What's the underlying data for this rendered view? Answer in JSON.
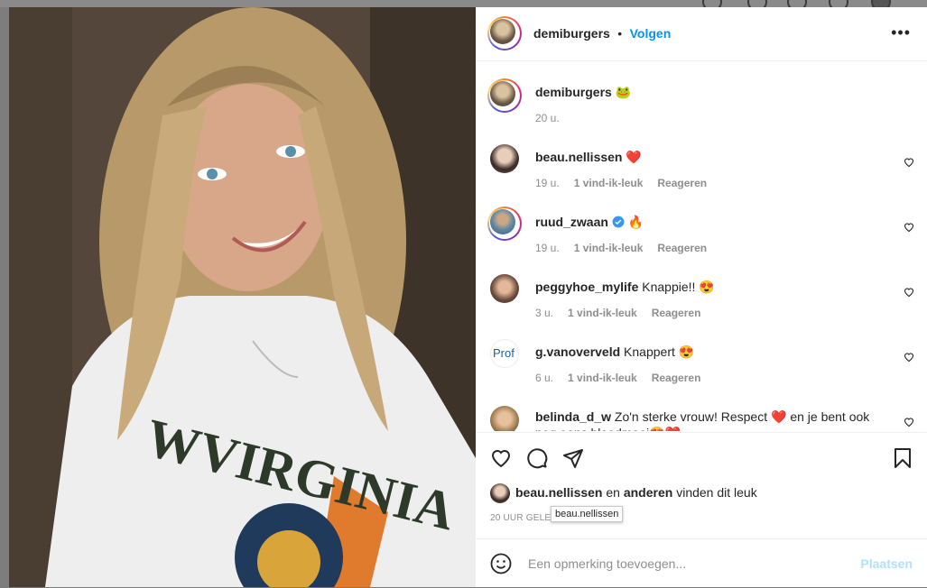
{
  "post": {
    "author": "demiburgers",
    "follow_label": "Volgen",
    "separator": "•",
    "more_label": "•••",
    "caption_emoji": "🐸",
    "caption_time": "20 u."
  },
  "comments": [
    {
      "user": "beau.nellissen",
      "text": "",
      "emoji": "❤️",
      "time": "19 u.",
      "likes": "1 vind-ik-leuk",
      "reply": "Reageren"
    },
    {
      "user": "ruud_zwaan",
      "text": "",
      "emoji": "🔥",
      "verified": true,
      "time": "19 u.",
      "likes": "1 vind-ik-leuk",
      "reply": "Reageren"
    },
    {
      "user": "peggyhoe_mylife",
      "text": "Knappie!!",
      "emoji": "😍",
      "time": "3 u.",
      "likes": "1 vind-ik-leuk",
      "reply": "Reageren"
    },
    {
      "user": "g.vanoverveld",
      "text": "Knappert",
      "emoji": "😍",
      "avatar_text": "Prof",
      "time": "6 u.",
      "likes": "1 vind-ik-leuk",
      "reply": "Reageren"
    },
    {
      "user": "belinda_d_w",
      "text": "Zo'n sterke vrouw! Respect ❤️ en je bent ook nog eens bloedmooi😍❤️"
    }
  ],
  "likes_line": {
    "user": "beau.nellissen",
    "conj": "en",
    "others": "anderen",
    "suffix": "vinden dit leuk"
  },
  "timestamp": "20 UUR GELE",
  "tooltip": "beau.nellissen",
  "add_comment": {
    "placeholder": "Een opmerking toevoegen...",
    "post_label": "Plaatsen"
  },
  "colors": {
    "link": "#0095f6",
    "post_disabled": "#b2dffc",
    "meta": "#8e8e8e"
  }
}
